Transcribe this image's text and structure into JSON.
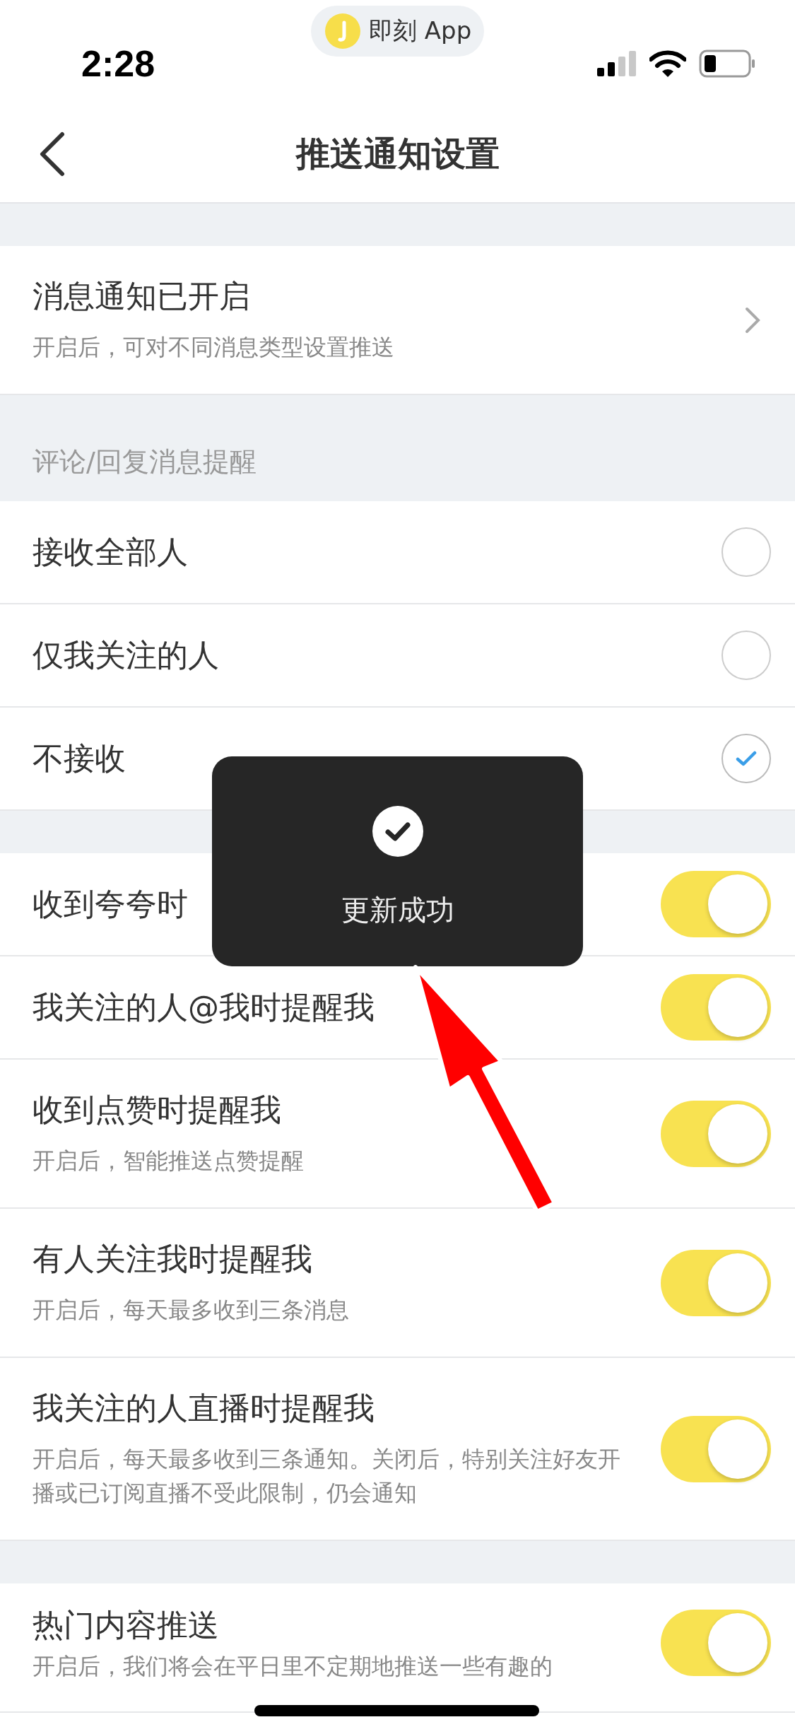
{
  "status_bar": {
    "time": "2:28",
    "app_pill": "即刻 App"
  },
  "nav": {
    "title": "推送通知设置"
  },
  "notification_row": {
    "title": "消息通知已开启",
    "subtitle": "开启后，可对不同消息类型设置推送"
  },
  "comment_section": {
    "header": "评论/回复消息提醒",
    "options": [
      {
        "label": "接收全部人",
        "selected": false
      },
      {
        "label": "仅我关注的人",
        "selected": false
      },
      {
        "label": "不接收",
        "selected": true
      }
    ]
  },
  "toggle_sections": [
    {
      "rows": [
        {
          "title": "收到夸夸时",
          "on": true
        },
        {
          "title": "我关注的人@我时提醒我",
          "on": true
        },
        {
          "title": "收到点赞时提醒我",
          "subtitle": "开启后，智能推送点赞提醒",
          "on": true
        },
        {
          "title": "有人关注我时提醒我",
          "subtitle": "开启后，每天最多收到三条消息",
          "on": true
        },
        {
          "title": "我关注的人直播时提醒我",
          "subtitle": "开启后，每天最多收到三条通知。关闭后，特别关注好友开播或已订阅直播不受此限制，仍会通知",
          "on": true
        }
      ]
    },
    {
      "rows": [
        {
          "title": "热门内容推送",
          "subtitle": "开启后，我们将会在平日里不定期地推送一些有趣的",
          "on": true
        }
      ]
    }
  ],
  "toast": {
    "text": "更新成功"
  }
}
